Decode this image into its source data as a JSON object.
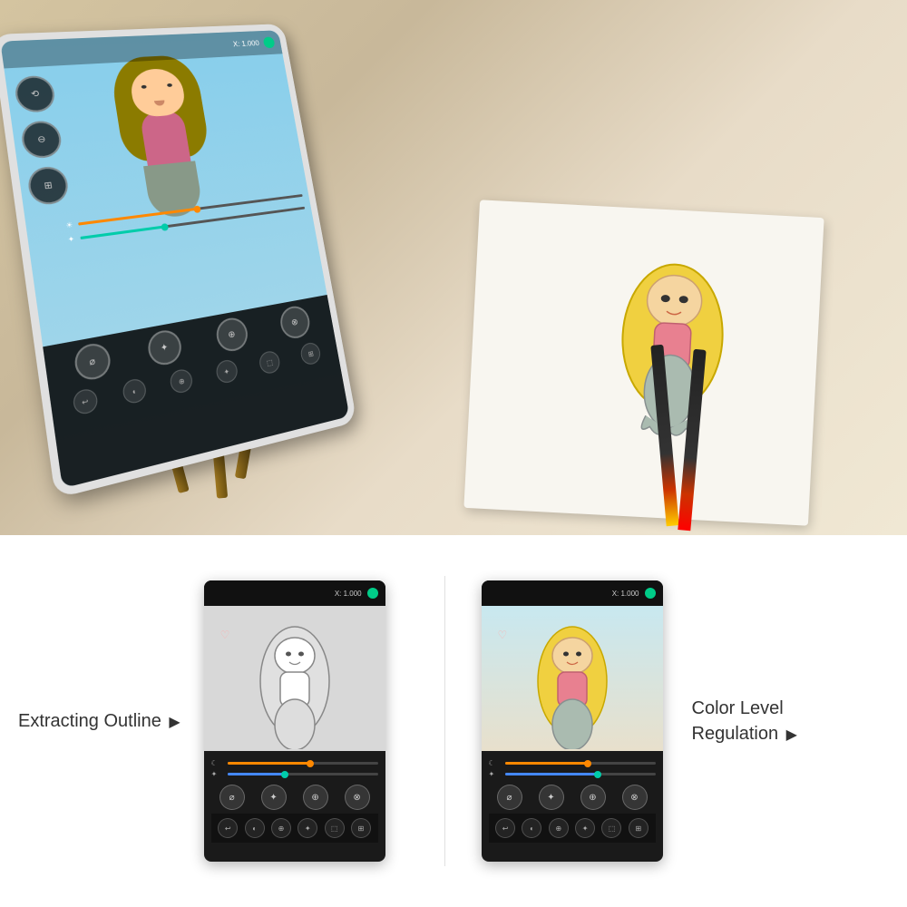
{
  "photo": {
    "alt": "Tablet on wooden stand with mermaid drawing app, next to paper drawing with markers"
  },
  "feature_left": {
    "title": "Extracting Outline",
    "arrow": "▶",
    "app_x_label": "X: 1.000",
    "slider1_fill": "55%",
    "slider2_fill": "40%",
    "icons": [
      "☾",
      "✦",
      "⊕",
      "⊗"
    ]
  },
  "feature_right": {
    "title": "Color Level\nRegulation",
    "arrow": "▶",
    "app_x_label": "X: 1.000",
    "slider1_fill": "55%",
    "slider2_fill": "60%",
    "icons": [
      "☾",
      "✦",
      "⊕",
      "⊗"
    ]
  },
  "bottom_icons": [
    "↩",
    "◐",
    "⊕",
    "✦",
    "⬚",
    "⊞"
  ],
  "colors": {
    "accent_green": "#00cc88",
    "accent_orange": "#ff8800",
    "accent_blue": "#4488ff",
    "accent_teal": "#00ccaa"
  }
}
